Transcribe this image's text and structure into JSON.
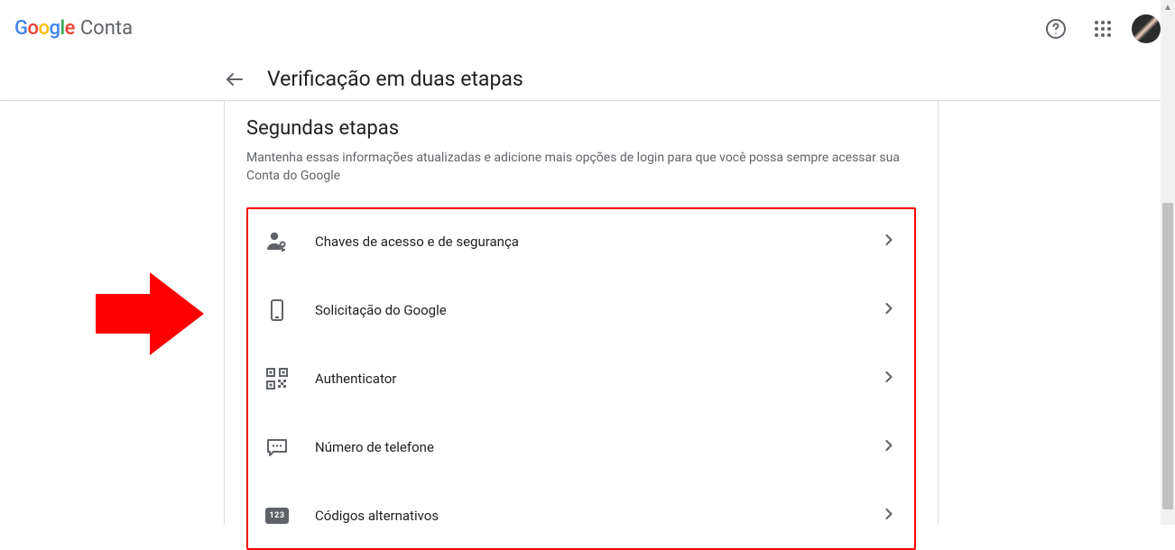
{
  "header": {
    "logo_text": "Google",
    "account_label": "Conta"
  },
  "subheader": {
    "page_title": "Verificação em duas etapas"
  },
  "section": {
    "title": "Segundas etapas",
    "description": "Mantenha essas informações atualizadas e adicione mais opções de login para que você possa sempre acessar sua Conta do Google"
  },
  "options": [
    {
      "label": "Chaves de acesso e de segurança",
      "icon": "passkey"
    },
    {
      "label": "Solicitação do Google",
      "icon": "phone"
    },
    {
      "label": "Authenticator",
      "icon": "qr"
    },
    {
      "label": "Número de telefone",
      "icon": "sms"
    },
    {
      "label": "Códigos alternativos",
      "icon": "codes"
    }
  ],
  "backup_codes_badge": "123"
}
